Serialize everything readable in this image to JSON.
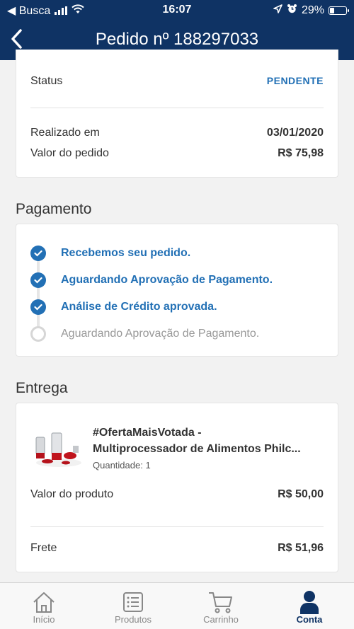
{
  "status_bar": {
    "carrier": "◀ Busca",
    "time": "16:07",
    "battery": "29%"
  },
  "header": {
    "title": "Pedido nº 188297033"
  },
  "order": {
    "status_label": "Status",
    "status_value": "PENDENTE",
    "date_label": "Realizado em",
    "date_value": "03/01/2020",
    "total_label": "Valor do pedido",
    "total_value": "R$  75,98"
  },
  "payment": {
    "section_title": "Pagamento",
    "steps": [
      {
        "label": "Recebemos seu pedido.",
        "done": true
      },
      {
        "label": "Aguardando Aprovação de Pagamento.",
        "done": true
      },
      {
        "label": "Análise de Crédito aprovada.",
        "done": true
      },
      {
        "label": "Aguardando Aprovação de Pagamento.",
        "done": false
      }
    ]
  },
  "delivery": {
    "section_title": "Entrega",
    "product_name_line1": "#OfertaMaisVotada -",
    "product_name_line2": "Multiprocessador de Alimentos Philc...",
    "quantity": "Quantidade: 1",
    "product_value_label": "Valor do produto",
    "product_value": "R$  50,00",
    "shipping_label": "Frete",
    "shipping_value": "R$  51,96"
  },
  "tabbar": {
    "items": [
      {
        "label": "Início",
        "icon": "home-icon",
        "active": false
      },
      {
        "label": "Produtos",
        "icon": "list-icon",
        "active": false
      },
      {
        "label": "Carrinho",
        "icon": "cart-icon",
        "active": false
      },
      {
        "label": "Conta",
        "icon": "user-icon",
        "active": true
      }
    ]
  },
  "colors": {
    "header_bg": "#0f3364",
    "accent_blue": "#2270b5"
  }
}
